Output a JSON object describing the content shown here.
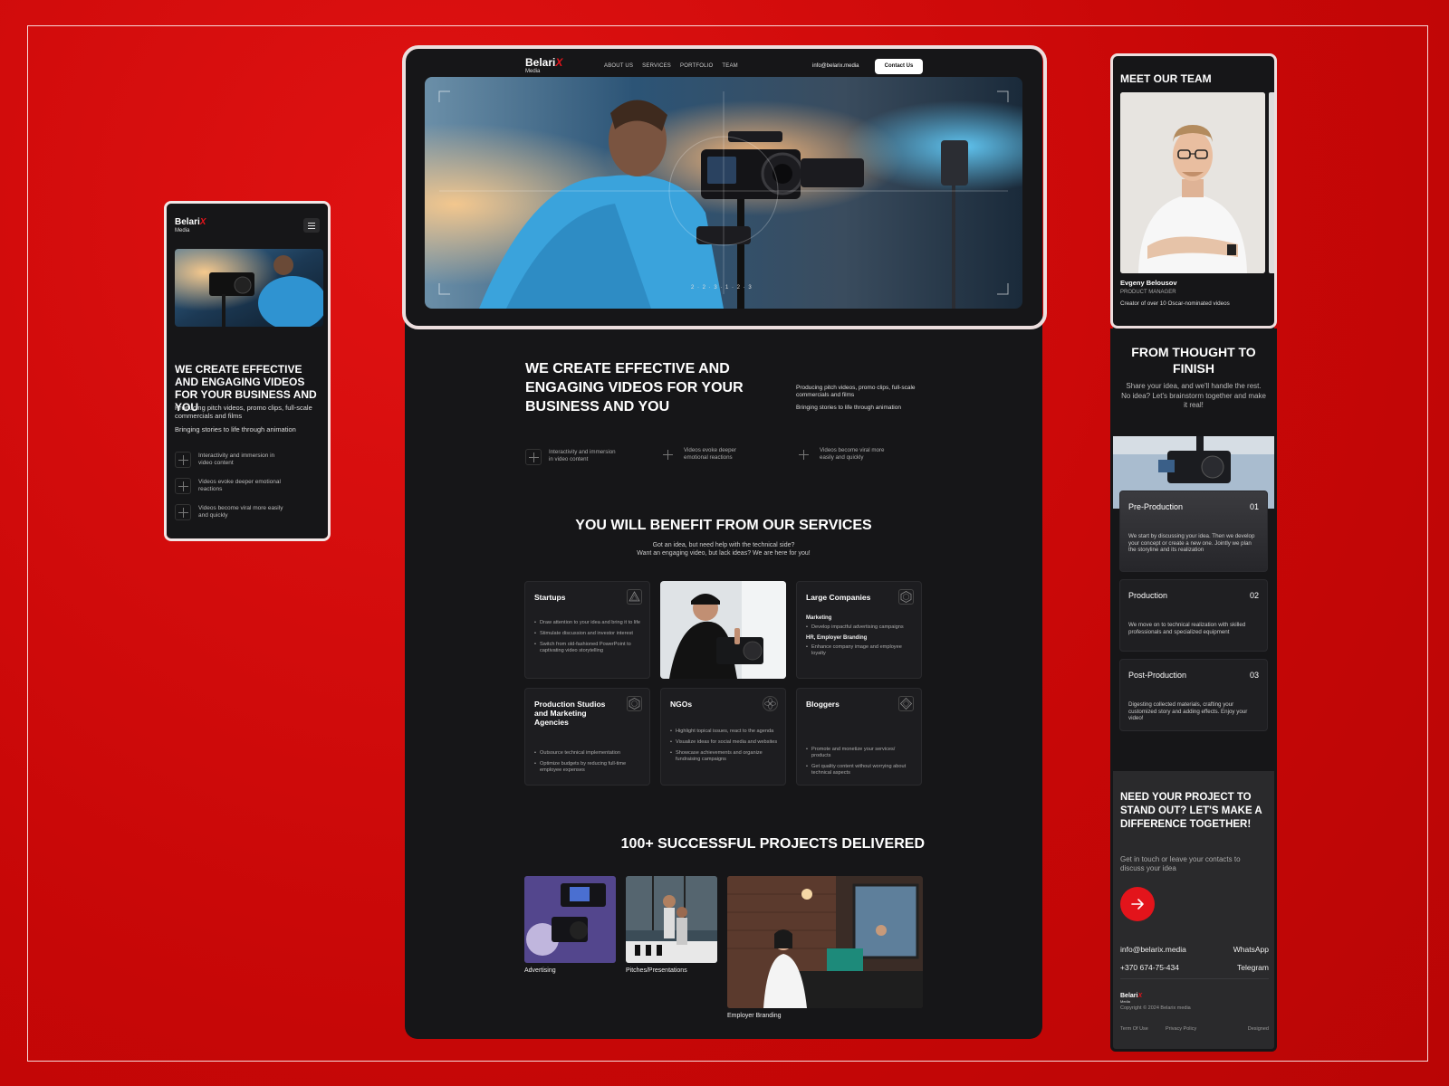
{
  "mobile": {
    "logo": "Belari",
    "logo_x": "X",
    "logo_sub": "Media",
    "headline": "WE CREATE EFFECTIVE AND ENGAGING VIDEOS FOR YOUR BUSINESS AND YOU",
    "para1": "Producing pitch videos, promo clips, full-scale commercials and films",
    "para2": "Bringing stories to life through animation",
    "features": [
      "Interactivity and immersion in video content",
      "Videos evoke deeper emotional reactions",
      "Videos become viral more easily and quickly"
    ]
  },
  "desktop": {
    "logo": "Belari",
    "logo_x": "X",
    "logo_sub": "Media",
    "nav": [
      "ABOUT US",
      "SERVICES",
      "PORTFOLIO",
      "TEAM"
    ],
    "email": "info@belarix.media",
    "contact_label": "Contact Us",
    "slider_indicator": "2 · 2 · 3 · 1 · 2 · 3",
    "headline": "WE CREATE EFFECTIVE AND ENGAGING VIDEOS FOR YOUR BUSINESS AND YOU",
    "para1": "Producing pitch videos, promo clips, full-scale commercials and films",
    "para2": "Bringing stories to life through animation",
    "features": [
      "Interactivity and immersion in video content",
      "Videos evoke deeper emotional reactions",
      "Videos become viral more easily and quickly"
    ],
    "services_title": "YOU WILL BENEFIT FROM OUR SERVICES",
    "services_sub1": "Got an idea, but need help with the technical side?",
    "services_sub2": "Want an engaging video, but lack ideas?  We are here for you!",
    "cards": {
      "startups": {
        "title": "Startups",
        "items": [
          "Draw attention to your idea and bring it to life",
          "Stimulate discussion and investor interest",
          "Switch from old-fashioned PowerPoint to captivating video storytelling"
        ]
      },
      "large": {
        "title": "Large Companies",
        "h1": "Marketing",
        "items1": [
          "Develop impactful advertising campaigns"
        ],
        "h2": "HR, Employer Branding",
        "items2": [
          "Enhance company image and employee loyalty"
        ]
      },
      "studios": {
        "title": "Production Studios and Marketing Agencies",
        "items": [
          "Outsource technical implementation",
          "Optimize budgets by reducing full-time employee expenses"
        ]
      },
      "ngos": {
        "title": "NGOs",
        "items": [
          "Highlight topical issues, react to the agenda",
          "Visualize ideas for social media and websites",
          "Showcase achievements and organize fundraising campaigns"
        ]
      },
      "bloggers": {
        "title": "Bloggers",
        "items": [
          "Promote and monetize your services/ products",
          "Get quality content without worrying about technical aspects"
        ]
      }
    },
    "projects_title": "100+ SUCCESSFUL PROJECTS DELIVERED",
    "projects": [
      "Advertising",
      "Pitches/Presentations",
      "Employer Branding"
    ]
  },
  "right": {
    "team_title": "MEET OUR TEAM",
    "member_name": "Evgeny Belousov",
    "member_role": "PRODUCT MANAGER",
    "member_desc": "Creator of over 10 Oscar-nominated videos",
    "process_title": "FROM THOUGHT TO FINISH",
    "process_sub1": "Share your idea, and we'll handle the rest.",
    "process_sub2": "No idea? Let's brainstorm together and make it real!",
    "steps": [
      {
        "title": "Pre-Production",
        "num": "01",
        "desc": "We start by discussing your idea. Then we develop your concept or create a new one. Jointly we plan the storyline and its realization"
      },
      {
        "title": "Production",
        "num": "02",
        "desc": "We move on to technical realization with skilled professionals and specialized equipment"
      },
      {
        "title": "Post-Production",
        "num": "03",
        "desc": "Digesting collected materials, crafting your customized story and adding effects. Enjoy your video!"
      }
    ],
    "cta_title": "NEED YOUR PROJECT TO STAND OUT? LET'S MAKE A DIFFERENCE TOGETHER!",
    "cta_sub": "Get in touch or leave your contacts to discuss your idea",
    "email": "info@belarix.media",
    "whatsapp": "WhatsApp",
    "phone": "+370 674-75-434",
    "telegram": "Telegram",
    "copyright": "Copyright © 2024 Belarix media",
    "terms": "Term Of Use",
    "privacy": "Privacy Policy",
    "designed": "Designed"
  },
  "colors": {
    "accent": "#e3141b",
    "background": "#d40a0a",
    "panel": "#161618"
  }
}
